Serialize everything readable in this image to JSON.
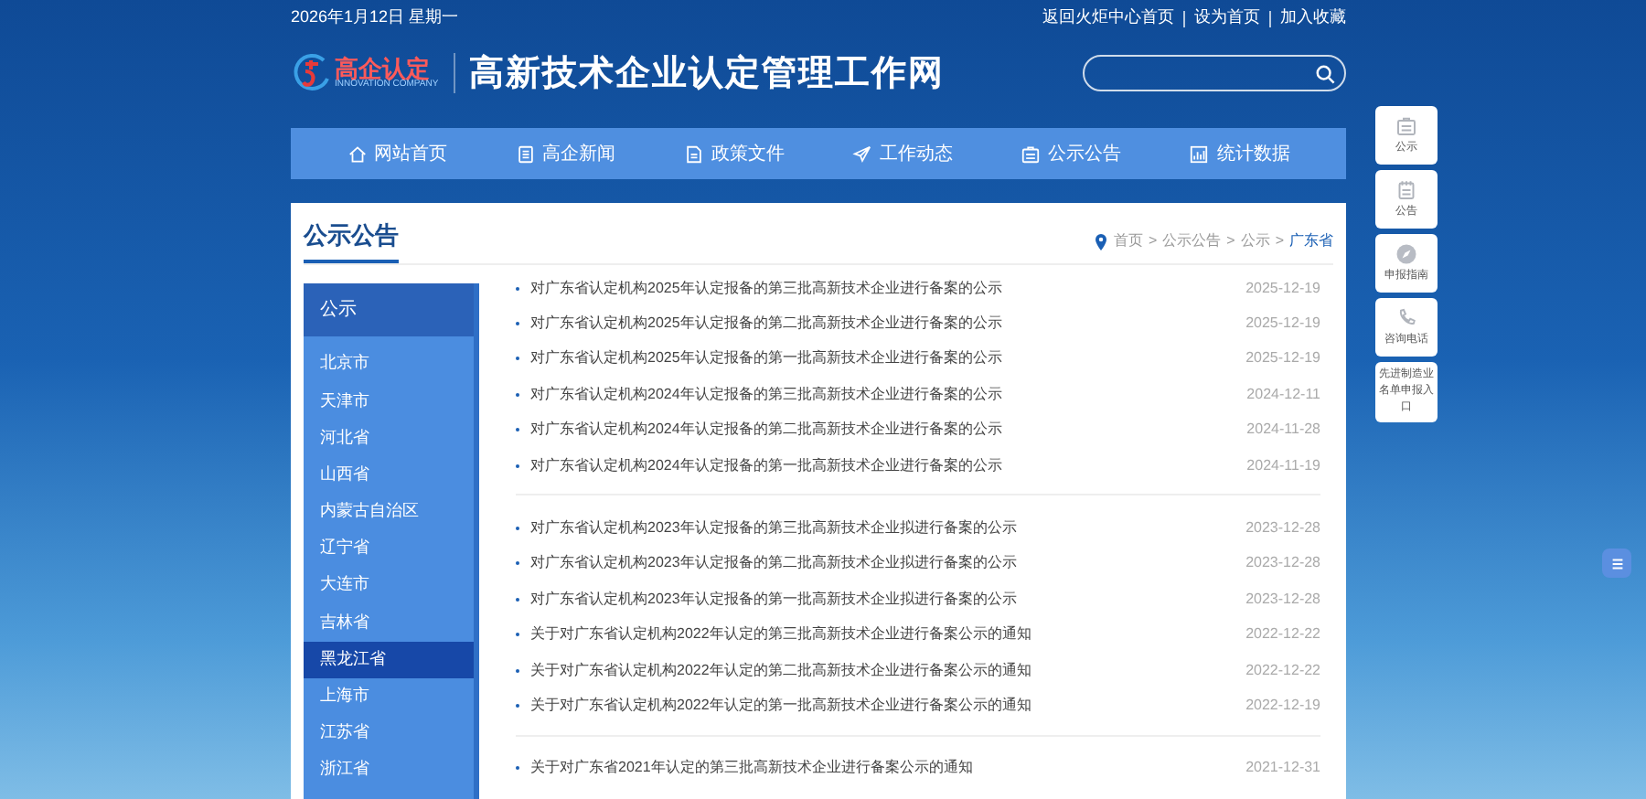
{
  "top_bar": {
    "date": "2026年1月12日 星期一",
    "links": [
      "返回火炬中心首页",
      "设为首页",
      "加入收藏"
    ]
  },
  "header": {
    "logo_text": "高企认定",
    "logo_subtext": "INNOVATION COMPANY",
    "site_title": "高新技术企业认定管理工作网"
  },
  "nav": [
    {
      "label": "网站首页",
      "kind": "home"
    },
    {
      "label": "高企新闻",
      "kind": "news"
    },
    {
      "label": "政策文件",
      "kind": "file"
    },
    {
      "label": "工作动态",
      "kind": "send"
    },
    {
      "label": "公示公告",
      "kind": "board"
    },
    {
      "label": "统计数据",
      "kind": "chart"
    }
  ],
  "page_title": "公示公告",
  "breadcrumb": [
    {
      "kind": "link",
      "text": "首页",
      "selected": false
    },
    {
      "kind": "separator",
      "text": ">"
    },
    {
      "kind": "link",
      "text": "公示公告",
      "selected": false
    },
    {
      "kind": "separator",
      "text": ">"
    },
    {
      "kind": "link",
      "text": "公示",
      "selected": false
    },
    {
      "kind": "separator",
      "text": ">"
    },
    {
      "kind": "link",
      "text": "广东省",
      "selected": true
    }
  ],
  "sidebar": {
    "heading": "公示",
    "items": [
      {
        "label": "北京市",
        "selected": false
      },
      {
        "label": "天津市",
        "selected": false
      },
      {
        "label": "河北省",
        "selected": false
      },
      {
        "label": "山西省",
        "selected": false
      },
      {
        "label": "内蒙古自治区",
        "selected": false
      },
      {
        "label": "辽宁省",
        "selected": false
      },
      {
        "label": "大连市",
        "selected": false
      },
      {
        "label": "吉林省",
        "selected": false
      },
      {
        "label": "黑龙江省",
        "selected": true
      },
      {
        "label": "上海市",
        "selected": false
      },
      {
        "label": "江苏省",
        "selected": false
      },
      {
        "label": "浙江省",
        "selected": false
      }
    ]
  },
  "list_groups": [
    [
      {
        "title": "对广东省认定机构2025年认定报备的第三批高新技术企业进行备案的公示",
        "date": "2025-12-19"
      },
      {
        "title": "对广东省认定机构2025年认定报备的第二批高新技术企业进行备案的公示",
        "date": "2025-12-19"
      },
      {
        "title": "对广东省认定机构2025年认定报备的第一批高新技术企业进行备案的公示",
        "date": "2025-12-19"
      },
      {
        "title": "对广东省认定机构2024年认定报备的第三批高新技术企业进行备案的公示",
        "date": "2024-12-11"
      },
      {
        "title": "对广东省认定机构2024年认定报备的第二批高新技术企业进行备案的公示",
        "date": "2024-11-28"
      },
      {
        "title": "对广东省认定机构2024年认定报备的第一批高新技术企业进行备案的公示",
        "date": "2024-11-19"
      }
    ],
    [
      {
        "title": "对广东省认定机构2023年认定报备的第三批高新技术企业拟进行备案的公示",
        "date": "2023-12-28"
      },
      {
        "title": "对广东省认定机构2023年认定报备的第二批高新技术企业拟进行备案的公示",
        "date": "2023-12-28"
      },
      {
        "title": "对广东省认定机构2023年认定报备的第一批高新技术企业拟进行备案的公示",
        "date": "2023-12-28"
      },
      {
        "title": "关于对广东省认定机构2022年认定的第三批高新技术企业进行备案公示的通知",
        "date": "2022-12-22"
      },
      {
        "title": "关于对广东省认定机构2022年认定的第二批高新技术企业进行备案公示的通知",
        "date": "2022-12-22"
      },
      {
        "title": "关于对广东省认定机构2022年认定的第一批高新技术企业进行备案公示的通知",
        "date": "2022-12-19"
      }
    ],
    [
      {
        "title": "关于对广东省2021年认定的第三批高新技术企业进行备案公示的通知",
        "date": "2021-12-31"
      }
    ]
  ],
  "float_menu": [
    {
      "label": "公示",
      "kind": "board"
    },
    {
      "label": "公告",
      "kind": "notes"
    },
    {
      "label": "申报指南",
      "kind": "compass"
    },
    {
      "label": "咨询电话",
      "kind": "phone"
    },
    {
      "label": "先进制造业名单申报入口",
      "kind": "text"
    }
  ]
}
